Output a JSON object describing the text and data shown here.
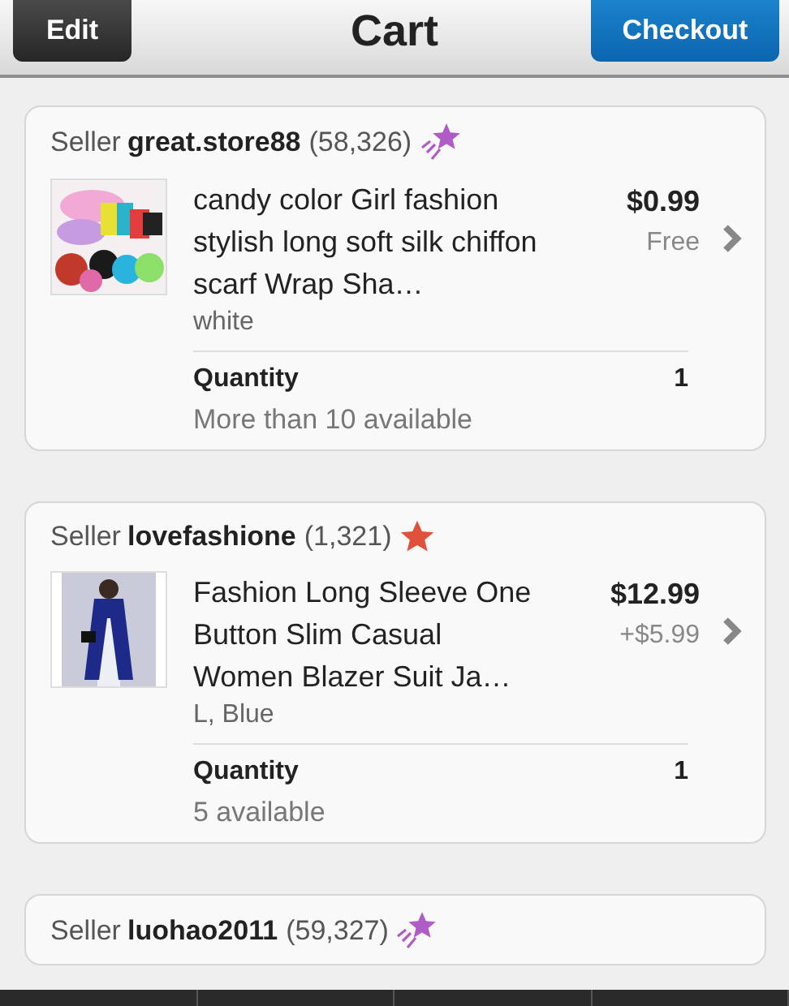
{
  "nav_bar": {
    "title": "Cart",
    "left_button": "Edit",
    "right_button": "Checkout"
  },
  "sellers": [
    {
      "label": "Seller",
      "name": "great.store88",
      "rating": "(58,326)",
      "badge": {
        "kind": "shooting-star",
        "color": "#b05cc6"
      },
      "item": {
        "title": "candy color Girl fashion stylish long soft silk chiffon scarf Wrap Sha…",
        "variant": "white",
        "price": "$0.99",
        "shipping": "Free",
        "quantity_label": "Quantity",
        "quantity": "1",
        "availability": "More than 10 available"
      }
    },
    {
      "label": "Seller",
      "name": "lovefashione",
      "rating": "(1,321)",
      "badge": {
        "kind": "star",
        "color": "#e0513c"
      },
      "item": {
        "title": "Fashion Long Sleeve One Button Slim Casual Women Blazer Suit Ja…",
        "variant": "L, Blue",
        "price": "$12.99",
        "shipping": "+$5.99",
        "quantity_label": "Quantity",
        "quantity": "1",
        "availability": "5 available"
      }
    },
    {
      "label": "Seller",
      "name": "luohao2011",
      "rating": "(59,327)",
      "badge": {
        "kind": "shooting-star",
        "color": "#b05cc6"
      }
    }
  ]
}
